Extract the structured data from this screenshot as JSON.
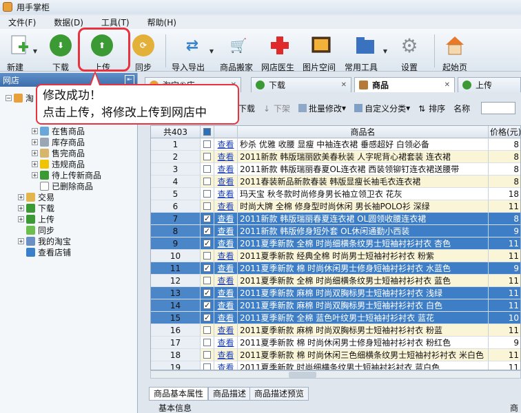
{
  "window": {
    "title": "用手掌柜"
  },
  "menu": [
    "文件(F)",
    "数据(D)",
    "工具(T)",
    "帮助(H)"
  ],
  "toolbar": [
    {
      "label": "新建",
      "icon": "new-icon",
      "dropdown": true
    },
    {
      "label": "下载",
      "icon": "download-icon",
      "dropdown": false
    },
    {
      "label": "上传",
      "icon": "upload-icon",
      "dropdown": false
    },
    {
      "label": "同步",
      "icon": "sync-icon",
      "dropdown": false
    },
    {
      "label": "导入导出",
      "icon": "import-export-icon",
      "dropdown": true
    },
    {
      "label": "商品搬家",
      "icon": "move-products-icon",
      "dropdown": false
    },
    {
      "label": "网店医生",
      "icon": "doctor-icon",
      "dropdown": false
    },
    {
      "label": "图片空间",
      "icon": "image-space-icon",
      "dropdown": false
    },
    {
      "label": "常用工具",
      "icon": "tools-icon",
      "dropdown": true
    },
    {
      "label": "设置",
      "icon": "gear-icon",
      "dropdown": false
    },
    {
      "label": "起始页",
      "icon": "home-icon",
      "dropdown": false
    }
  ],
  "left_panel": {
    "title": "网店",
    "tree": [
      "淘",
      "在售商品",
      "库存商品",
      "售完商品",
      "违规商品",
      "待上传新商品",
      "已删除商品",
      "交易",
      "下载",
      "上传",
      "同步",
      "我的淘宝",
      "查看店铺"
    ]
  },
  "callout": {
    "line1": "修改成功！",
    "line2": "点击上传，将修改上传到网店中"
  },
  "tabs": [
    "淘宝①店",
    "下载",
    "商品",
    "上传"
  ],
  "subtoolbar": {
    "download": "下载",
    "shelve_down": "下架",
    "batch_edit": "批量修改",
    "custom_category": "自定义分类",
    "sort": "排序",
    "name_label": "名称"
  },
  "grid": {
    "count_label": "共403",
    "col_name": "商品名",
    "col_price": "价格(元)",
    "view_label": "查看",
    "rows": [
      {
        "n": "1",
        "name": "秒杀 优雅 收腰 显瘦 中袖连衣裙 垂感超好 白领必备",
        "price": "8",
        "checked": false,
        "sel": false,
        "alt": false
      },
      {
        "n": "2",
        "name": "2011新款 韩版瑞丽欧美春秋装 人字呢背心裙套装 连衣裙",
        "price": "8",
        "checked": false,
        "sel": false,
        "alt": true
      },
      {
        "n": "3",
        "name": "2011新款 韩版瑞丽春夏OL连衣裙 西装领铆钉连衣裙送腰带",
        "price": "8",
        "checked": false,
        "sel": false,
        "alt": false
      },
      {
        "n": "4",
        "name": "2011春装新品新款春装 韩版显瘦长袖毛衣连衣裙",
        "price": "8",
        "checked": false,
        "sel": false,
        "alt": true
      },
      {
        "n": "5",
        "name": "玛天宝 秋冬款时尚修身男长袖立领卫衣 花灰",
        "price": "18",
        "checked": false,
        "sel": false,
        "alt": false
      },
      {
        "n": "6",
        "name": "时尚大牌 全棉 修身型时尚休闲 男长袖POLO衫 深绿",
        "price": "11",
        "checked": false,
        "sel": false,
        "alt": true
      },
      {
        "n": "7",
        "name": "2011新款 韩版瑞丽春夏连衣裙 OL圆领收腰连衣裙",
        "price": "8",
        "checked": true,
        "sel": true,
        "alt": false
      },
      {
        "n": "8",
        "name": "2011新款 韩版修身短外套 OL休闲通勤小西装",
        "price": "9",
        "checked": true,
        "sel": true,
        "alt": false
      },
      {
        "n": "9",
        "name": "2011夏季新款 全棉 时尚细横条纹男士短袖衬衫衬衣 杏色",
        "price": "11",
        "checked": true,
        "sel": true,
        "alt": false
      },
      {
        "n": "10",
        "name": "2011夏季新款 经典全棉 时尚男士短袖衬衫衬衣 粉紫",
        "price": "11",
        "checked": false,
        "sel": false,
        "alt": true
      },
      {
        "n": "11",
        "name": "2011夏季新款 棉 时尚休闲男士修身短袖衬衫衬衣 水蓝色",
        "price": "9",
        "checked": true,
        "sel": true,
        "alt": false
      },
      {
        "n": "12",
        "name": "2011夏季新款 全棉 时尚细横条纹男士短袖衬衫衬衣 蓝色",
        "price": "11",
        "checked": false,
        "sel": false,
        "alt": true
      },
      {
        "n": "13",
        "name": "2011夏季新款 麻棉 时尚双胸标男士短袖衬衫衬衣 浅绿",
        "price": "11",
        "checked": true,
        "sel": true,
        "alt": false
      },
      {
        "n": "14",
        "name": "2011夏季新款 麻棉 时尚双胸标男士短袖衬衫衬衣 白色",
        "price": "11",
        "checked": true,
        "sel": true,
        "alt": false
      },
      {
        "n": "15",
        "name": "2011夏季新款 全棉 蓝色叶纹男士短袖衬衫衬衣 蓝花",
        "price": "10",
        "checked": true,
        "sel": true,
        "alt": false
      },
      {
        "n": "16",
        "name": "2011夏季新款 麻棉 时尚双胸标男士短袖衬衫衬衣 粉蓝",
        "price": "11",
        "checked": false,
        "sel": false,
        "alt": true
      },
      {
        "n": "17",
        "name": "2011夏季新款 棉 时尚休闲男士修身短袖衬衫衬衣 粉红色",
        "price": "9",
        "checked": false,
        "sel": false,
        "alt": false
      },
      {
        "n": "18",
        "name": "2011夏季新款 棉 时尚休闲三色细横条纹男士短袖衬衫衬衣 米白色",
        "price": "11",
        "checked": false,
        "sel": false,
        "alt": true
      },
      {
        "n": "19",
        "name": "2011夏季新款 时尚细横条纹男士短袖衬衫衬衣 蓝白色",
        "price": "11",
        "checked": false,
        "sel": false,
        "alt": false
      }
    ]
  },
  "bottom_tabs": [
    "商品基本属性",
    "商品描述",
    "商品描述预览"
  ],
  "basic_info": "基本信息",
  "basic_right": "商品"
}
